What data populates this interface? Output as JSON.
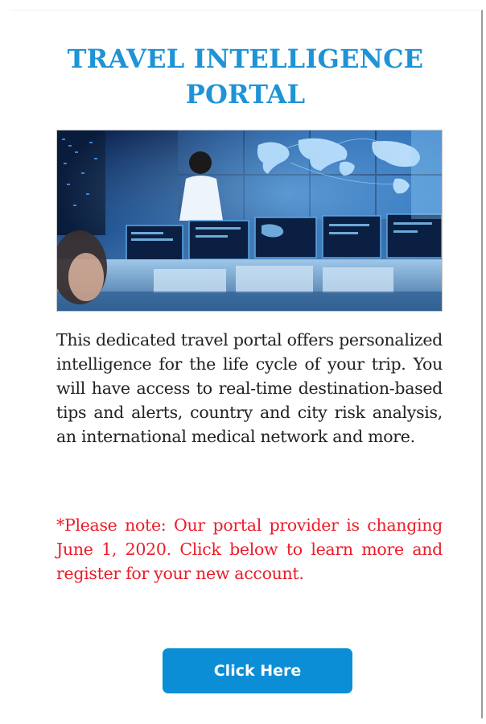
{
  "header": {
    "title": "TRAVEL INTELLIGENCE PORTAL"
  },
  "hero_image": {
    "alt": "Operators monitoring screens in a global operations center",
    "accent_colors": [
      "#0d2a5c",
      "#1f5fa8",
      "#6fb6ea",
      "#d9ecfa"
    ]
  },
  "content": {
    "description": "This dedicated travel portal offers personalized intelligence for the life cycle of your trip. You will have access to real-time destination-based tips and alerts, country and city risk analysis, an international medical network and more.",
    "note": "*Please note: Our portal provider is changing June 1, 2020. Click below to learn more and register for your new account."
  },
  "cta": {
    "label": "Click Here",
    "color": "#0b8ed6"
  },
  "colors": {
    "title": "#1e93d6",
    "note": "#ec1c2a",
    "body": "#222222"
  }
}
